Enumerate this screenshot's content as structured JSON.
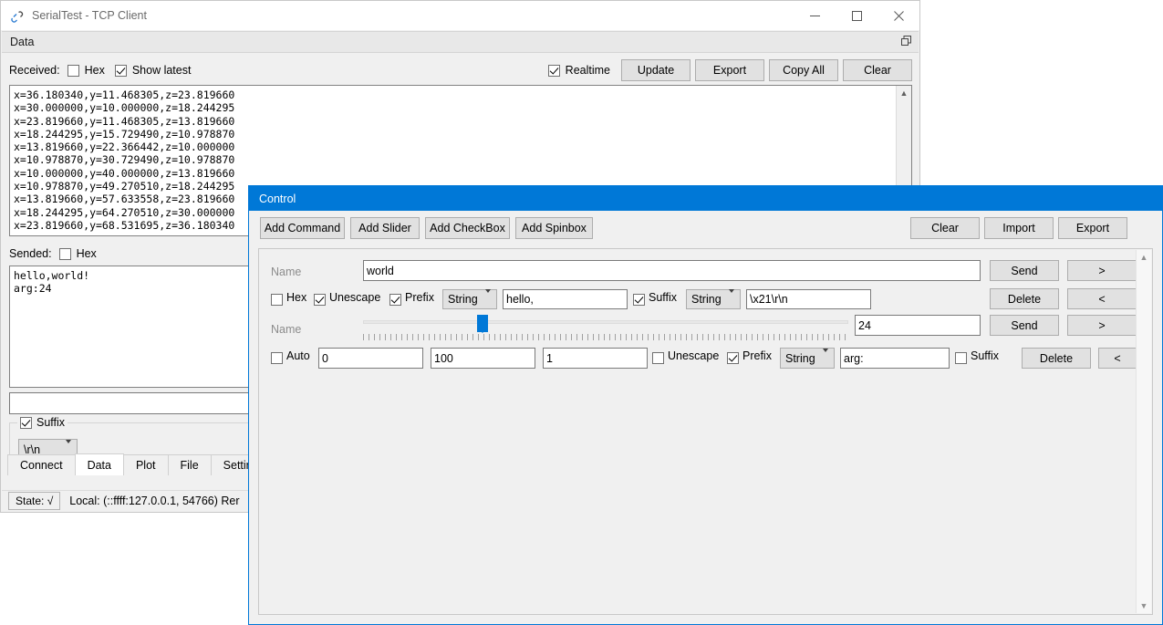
{
  "main_window": {
    "title": "SerialTest - TCP Client",
    "icon": "app-link-icon",
    "window_buttons": {
      "minimize": "minimize-icon",
      "maximize": "maximize-icon",
      "close": "close-icon"
    },
    "dock_panel": {
      "title": "Data",
      "float_icon": "float-restore-icon"
    },
    "received": {
      "label": "Received:",
      "hex_label": "Hex",
      "hex_checked": false,
      "show_latest_label": "Show latest",
      "show_latest_checked": true,
      "realtime_label": "Realtime",
      "realtime_checked": true,
      "buttons": [
        "Update",
        "Export",
        "Copy All",
        "Clear"
      ],
      "text": "x=36.180340,y=11.468305,z=23.819660\nx=30.000000,y=10.000000,z=18.244295\nx=23.819660,y=11.468305,z=13.819660\nx=18.244295,y=15.729490,z=10.978870\nx=13.819660,y=22.366442,z=10.000000\nx=10.978870,y=30.729490,z=10.978870\nx=10.000000,y=40.000000,z=13.819660\nx=10.978870,y=49.270510,z=18.244295\nx=13.819660,y=57.633558,z=23.819660\nx=18.244295,y=64.270510,z=30.000000\nx=23.819660,y=68.531695,z=36.180340"
    },
    "sended": {
      "label": "Sended:",
      "hex_label": "Hex",
      "hex_checked": false,
      "text": "hello,world!\narg:24"
    },
    "send_input": {
      "value": "",
      "placeholder": ""
    },
    "suffix_group": {
      "label": "Suffix",
      "checked": true,
      "value": "\\r\\n"
    },
    "tabs": [
      {
        "label": "Connect",
        "active": false
      },
      {
        "label": "Data",
        "active": true
      },
      {
        "label": "Plot",
        "active": false
      },
      {
        "label": "File",
        "active": false
      },
      {
        "label": "Settings",
        "active": false
      }
    ],
    "statusbar": {
      "state": "State: √",
      "info": "Local: (::ffff:127.0.0.1, 54766) Rer"
    }
  },
  "control_window": {
    "title": "Control",
    "toolbar": {
      "add_buttons": [
        "Add Command",
        "Add Slider",
        "Add CheckBox",
        "Add Spinbox"
      ],
      "right_buttons": [
        "Clear",
        "Import",
        "Export"
      ]
    },
    "items": [
      {
        "type": "command",
        "name_placeholder": "Name",
        "name_value": "world",
        "hex_label": "Hex",
        "hex_checked": false,
        "unescape_label": "Unescape",
        "unescape_checked": true,
        "prefix_label": "Prefix",
        "prefix_checked": true,
        "prefix_type": "String",
        "prefix_value": "hello,",
        "suffix_label": "Suffix",
        "suffix_checked": true,
        "suffix_type": "String",
        "suffix_value": "\\x21\\r\\n",
        "send_label": "Send",
        "delete_label": "Delete",
        "move_up_label": ">",
        "move_down_label": "<"
      },
      {
        "type": "slider",
        "name_placeholder": "Name",
        "name_value": "",
        "slider_value": "24",
        "slider_min": "0",
        "slider_max": "100",
        "slider_step": "1",
        "slider_percent": 24,
        "auto_label": "Auto",
        "auto_checked": false,
        "unescape_label": "Unescape",
        "unescape_checked": false,
        "prefix_label": "Prefix",
        "prefix_checked": true,
        "prefix_type": "String",
        "prefix_value": "arg:",
        "suffix_label": "Suffix",
        "suffix_checked": false,
        "send_label": "Send",
        "delete_label": "Delete",
        "move_up_label": ">",
        "move_down_label": "<"
      }
    ]
  },
  "colors": {
    "accent": "#0078d7",
    "window_bg": "#f0f0f0",
    "button_bg": "#e1e1e1",
    "placeholder": "#8c8c8c"
  }
}
